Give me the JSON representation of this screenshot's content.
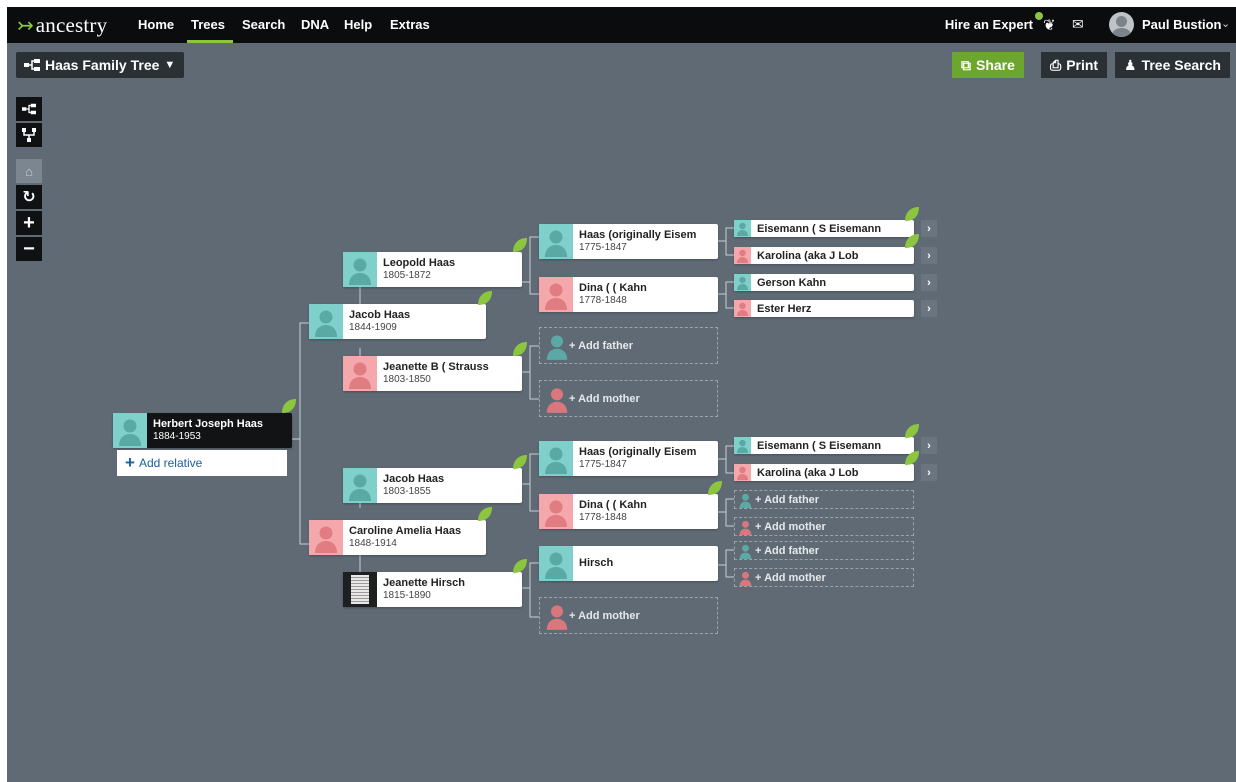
{
  "nav": {
    "logo": "ancestry",
    "items": [
      "Home",
      "Trees",
      "Search",
      "DNA",
      "Help",
      "Extras"
    ],
    "hire_expert": "Hire an Expert",
    "user_name": "Paul Bustion",
    "active_color": "#8cc63f"
  },
  "toolbar": {
    "tree_name": "Haas Family Tree",
    "share": "Share",
    "print": "Print",
    "tree_search": "Tree Search"
  },
  "tree": {
    "root": {
      "name": "Herbert Joseph Haas",
      "dates": "1884-1953",
      "add_relative": "Add relative"
    },
    "gen1": [
      {
        "name": "Jacob Haas",
        "dates": "1844-1909",
        "sex": "m"
      },
      {
        "name": "Caroline Amelia Haas",
        "dates": "1848-1914",
        "sex": "f"
      }
    ],
    "gen2": [
      {
        "name": "Leopold Haas",
        "dates": "1805-1872",
        "sex": "m"
      },
      {
        "name": "Jeanette B ( Strauss",
        "dates": "1803-1850",
        "sex": "f"
      },
      {
        "name": "Jacob Haas",
        "dates": "1803-1855",
        "sex": "m"
      },
      {
        "name": "Jeanette Hirsch",
        "dates": "1815-1890",
        "sex": "f"
      }
    ],
    "gen3": [
      {
        "name": "Haas (originally Eisem",
        "dates": "1775-1847",
        "sex": "m"
      },
      {
        "name": "Dina ( ( Kahn",
        "dates": "1778-1848",
        "sex": "f"
      },
      {
        "add": "Add father"
      },
      {
        "add": "Add mother"
      },
      {
        "name": "Haas (originally Eisem",
        "dates": "1775-1847",
        "sex": "m"
      },
      {
        "name": "Dina ( ( Kahn",
        "dates": "1778-1848",
        "sex": "f"
      },
      {
        "name": "Hirsch",
        "dates": "",
        "sex": "m"
      },
      {
        "add": "Add mother"
      }
    ],
    "gen4": [
      {
        "name": "Eisemann ( S Eisemann",
        "sex": "m"
      },
      {
        "name": "Karolina (aka J Lob",
        "sex": "f"
      },
      {
        "name": "Gerson Kahn",
        "sex": "m"
      },
      {
        "name": "Ester Herz",
        "sex": "f"
      },
      {
        "name": "Eisemann ( S Eisemann",
        "sex": "m"
      },
      {
        "name": "Karolina (aka J Lob",
        "sex": "f"
      },
      {
        "add": "Add father"
      },
      {
        "add": "Add mother"
      },
      {
        "add": "Add father"
      },
      {
        "add": "Add mother"
      }
    ]
  },
  "colors": {
    "male": "#7fcfcb",
    "female": "#f4a8ab",
    "hint_leaf": "#8cc63f",
    "canvas": "#5f6a75"
  },
  "icons": [
    "pedigree-view-icon",
    "family-view-icon",
    "home-icon",
    "reset-icon",
    "zoom-in-icon",
    "zoom-out-icon",
    "leaf-hint-icon",
    "mail-icon",
    "share-icon",
    "print-icon",
    "tree-search-icon"
  ]
}
